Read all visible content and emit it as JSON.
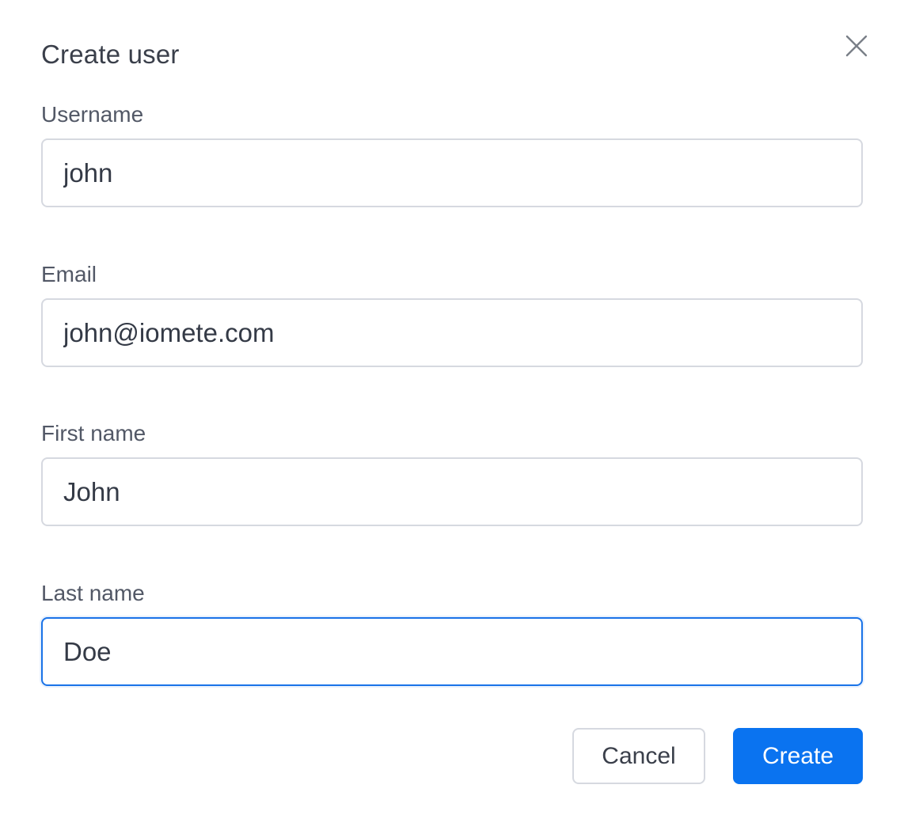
{
  "dialog": {
    "title": "Create user",
    "close_icon": "close-icon"
  },
  "form": {
    "username": {
      "label": "Username",
      "value": "john"
    },
    "email": {
      "label": "Email",
      "value": "john@iomete.com"
    },
    "first_name": {
      "label": "First name",
      "value": "John"
    },
    "last_name": {
      "label": "Last name",
      "value": "Doe",
      "focused": true
    }
  },
  "actions": {
    "cancel_label": "Cancel",
    "create_label": "Create"
  },
  "colors": {
    "primary": "#0a73f0",
    "focus_border": "#1a73e8",
    "input_border": "#d6d9e0"
  }
}
